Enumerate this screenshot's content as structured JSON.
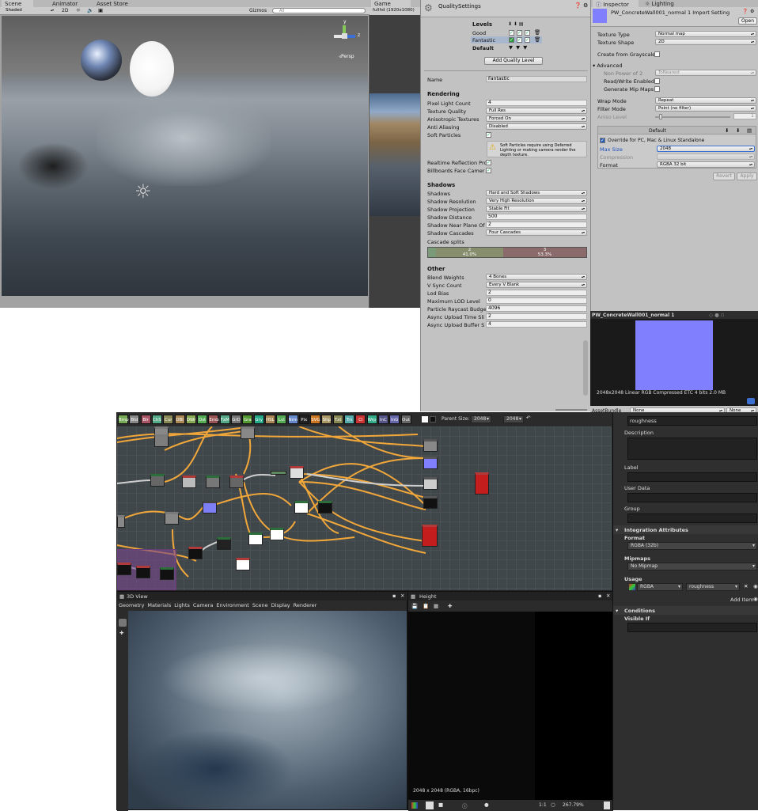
{
  "scene": {
    "tab_scene": "Scene",
    "tab_animator": "Animator",
    "tab_asset_store": "Asset Store",
    "shaded": "Shaded",
    "mode_2d": "2D",
    "gizmos": "Gizmos",
    "search_placeholder": "All",
    "persp": "◃Persp",
    "axis_y": "y",
    "axis_z": "z"
  },
  "game": {
    "tab": "Game",
    "resolution": "fullhd (1920x1080)"
  },
  "quality": {
    "title": "QualitySettings",
    "levels_label": "Levels",
    "levels": [
      "Good",
      "Fantastic",
      "Default"
    ],
    "add_button": "Add Quality Level",
    "name_label": "Name",
    "name_value": "Fantastic",
    "rendering_header": "Rendering",
    "rendering": [
      {
        "label": "Pixel Light Count",
        "value": "4",
        "kind": "field"
      },
      {
        "label": "Texture Quality",
        "value": "Full Res",
        "kind": "dd"
      },
      {
        "label": "Anisotropic Textures",
        "value": "Forced On",
        "kind": "dd"
      },
      {
        "label": "Anti Aliasing",
        "value": "Disabled",
        "kind": "dd"
      },
      {
        "label": "Soft Particles",
        "value": "",
        "kind": "check"
      }
    ],
    "warning": "Soft Particles require using Deferred Lighting or making camera render the depth texture.",
    "realtime_reflection": "Realtime Reflection Pro",
    "billboards": "Billboards Face Camer",
    "shadows_header": "Shadows",
    "shadows": [
      {
        "label": "Shadows",
        "value": "Hard and Soft Shadows",
        "kind": "dd"
      },
      {
        "label": "Shadow Resolution",
        "value": "Very High Resolution",
        "kind": "dd"
      },
      {
        "label": "Shadow Projection",
        "value": "Stable Fit",
        "kind": "dd"
      },
      {
        "label": "Shadow Distance",
        "value": "500",
        "kind": "field"
      },
      {
        "label": "Shadow Near Plane Of",
        "value": "2",
        "kind": "field"
      },
      {
        "label": "Shadow Cascades",
        "value": "Four Cascades",
        "kind": "dd"
      }
    ],
    "cascade_label": "Cascade splits",
    "cascade_splits": [
      {
        "top": "2",
        "bottom": "41.0%"
      },
      {
        "top": "3",
        "bottom": "53.3%"
      }
    ],
    "other_header": "Other",
    "other": [
      {
        "label": "Blend Weights",
        "value": "4 Bones",
        "kind": "dd"
      },
      {
        "label": "V Sync Count",
        "value": "Every V Blank",
        "kind": "dd"
      },
      {
        "label": "Lod Bias",
        "value": "2",
        "kind": "field"
      },
      {
        "label": "Maximum LOD Level",
        "value": "0",
        "kind": "field"
      },
      {
        "label": "Particle Raycast Budge",
        "value": "4096",
        "kind": "field"
      },
      {
        "label": "Async Upload Time Sli",
        "value": "2",
        "kind": "field"
      },
      {
        "label": "Async Upload Buffer S",
        "value": "4",
        "kind": "field"
      }
    ]
  },
  "inspector": {
    "tab_inspector": "Inspector",
    "tab_lighting": "Lighting",
    "asset_title": "PW_ConcreteWall001_normal 1 Import Setting",
    "open": "Open",
    "texture_type_label": "Texture Type",
    "texture_type": "Normal map",
    "texture_shape_label": "Texture Shape",
    "texture_shape": "2D",
    "grayscale": "Create from Grayscale",
    "advanced": "Advanced",
    "non_power": "Non Power of 2",
    "non_power_value": "ToNearest",
    "read_write": "Read/Write Enabled",
    "gen_mip": "Generate Mip Maps",
    "wrap_label": "Wrap Mode",
    "wrap": "Repeat",
    "filter_label": "Filter Mode",
    "filter": "Point (no filter)",
    "aniso": "Aniso Level",
    "aniso_value": "1",
    "platform_default": "Default",
    "override": "Override for PC, Mac & Linux Standalone",
    "max_size_label": "Max Size",
    "max_size": "2048",
    "compression_label": "Compression",
    "format_label": "Format",
    "format": "RGBA 32 bit",
    "revert": "Revert",
    "apply": "Apply",
    "preview_title": "PW_ConcreteWall001_normal 1",
    "preview_info": "2048x2048 Linear  RGB Compressed ETC 4 bits   2.0 MB",
    "asset_bundle": "AssetBundle",
    "none1": "None",
    "none2": "None",
    "normal_color": "#8080ff"
  },
  "designer": {
    "toolbar_nodes": [
      "Bmp",
      "Bld",
      "Blr",
      "ChS",
      "Cur",
      "DBl",
      "DWr",
      "Dst",
      "Emb",
      "FxM",
      "GrD",
      "Gra",
      "Gry",
      "HSL",
      "Lvl",
      "Nrm",
      "Pix",
      "SVG",
      "Shp",
      "Txt",
      "Trs",
      "Cl",
      "Wrp",
      "InC",
      "InG",
      "Out"
    ],
    "parent_size_label": "Parent Size:",
    "parent_size": "2048",
    "size": "2048"
  },
  "view3d": {
    "title": "3D View",
    "menu": [
      "Geometry",
      "Materials",
      "Lights",
      "Camera",
      "Environment",
      "Scene",
      "Display",
      "Renderer"
    ]
  },
  "height": {
    "title": "Height",
    "info": "2048 x 2048 (RGBA, 16bpc)",
    "zoom": "267.79%",
    "ratio": "1:1"
  },
  "props": {
    "identifier": "roughness",
    "description": "Description",
    "label": "Label",
    "user_data": "User Data",
    "group": "Group",
    "integration": "Integration Attributes",
    "format_label": "Format",
    "format": "RGBA (32b)",
    "mipmaps_label": "Mipmaps",
    "mipmaps": "No Mipmap",
    "usage_label": "Usage",
    "usage_1": "RGBA",
    "usage_2": "roughness",
    "add_item": "Add Item",
    "conditions": "Conditions",
    "visible_if": "Visible If"
  }
}
